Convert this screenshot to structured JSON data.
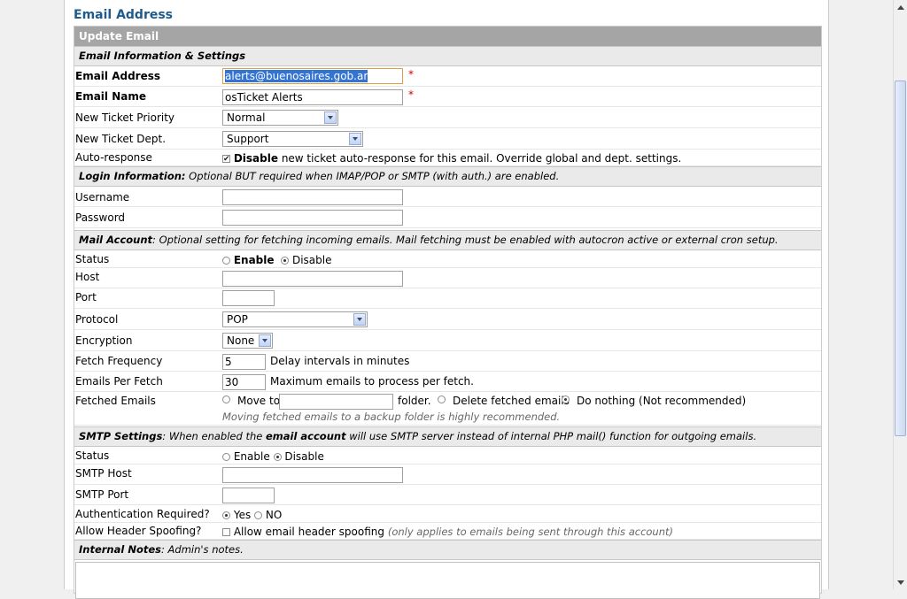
{
  "page_title": "Email Address",
  "form": {
    "header": "Update Email",
    "section_email": "Email Information & Settings",
    "email_address": {
      "label": "Email Address",
      "value": "alerts@buenosaires.gob.ar",
      "required": "*"
    },
    "email_name": {
      "label": "Email Name",
      "value": "osTicket Alerts",
      "required": "*"
    },
    "priority": {
      "label": "New Ticket Priority",
      "value": "Normal"
    },
    "dept": {
      "label": "New Ticket Dept.",
      "value": "Support"
    },
    "autoresponse": {
      "label": "Auto-response",
      "strong": "Disable",
      "text": "new ticket auto-response for this email. Override global and dept. settings."
    },
    "section_login": {
      "title": "Login Information:",
      "text": "Optional BUT required when IMAP/POP or SMTP (with auth.) are enabled."
    },
    "username": {
      "label": "Username",
      "value": ""
    },
    "password": {
      "label": "Password",
      "value": ""
    },
    "section_mail": {
      "title": "Mail Account",
      "text": ": Optional setting for fetching incoming emails. Mail fetching must be enabled with autocron active or external cron setup."
    },
    "mail_status": {
      "label": "Status",
      "enable": "Enable",
      "disable": "Disable"
    },
    "host": {
      "label": "Host",
      "value": ""
    },
    "port": {
      "label": "Port",
      "value": ""
    },
    "protocol": {
      "label": "Protocol",
      "value": "POP"
    },
    "encryption": {
      "label": "Encryption",
      "value": "None"
    },
    "fetch_freq": {
      "label": "Fetch Frequency",
      "value": "5",
      "text": "Delay intervals in minutes"
    },
    "per_fetch": {
      "label": "Emails Per Fetch",
      "value": "30",
      "text": "Maximum emails to process per fetch."
    },
    "fetched": {
      "label": "Fetched Emails",
      "move": "Move to:",
      "folder": "folder.",
      "delete": "Delete fetched emails",
      "nothing": "Do nothing (Not recommended)",
      "hint": "Moving fetched emails to a backup folder is highly recommended."
    },
    "section_smtp": {
      "title": "SMTP Settings",
      "pre": ": When enabled the ",
      "strong": "email account",
      "post": " will use SMTP server instead of internal PHP mail() function for outgoing emails."
    },
    "smtp_status": {
      "label": "Status",
      "enable": "Enable",
      "disable": "Disable"
    },
    "smtp_host": {
      "label": "SMTP Host",
      "value": ""
    },
    "smtp_port": {
      "label": "SMTP Port",
      "value": ""
    },
    "auth": {
      "label": "Authentication Required?",
      "yes": "Yes",
      "no": "NO"
    },
    "spoof": {
      "label": "Allow Header Spoofing?",
      "text": "Allow email header spoofing",
      "hint": "(only applies to emails being sent through this account)"
    },
    "section_notes": {
      "title": "Internal Notes",
      "text": ": Admin's notes."
    }
  }
}
